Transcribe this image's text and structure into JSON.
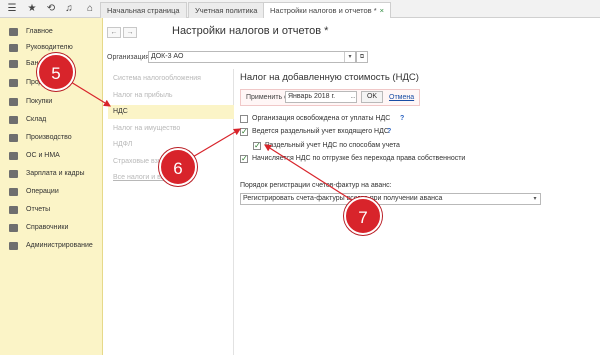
{
  "topbar": {
    "icons": [
      "grid-icon",
      "star-icon",
      "history-icon",
      "bell-icon",
      "home-icon"
    ],
    "tabs": [
      {
        "label": "Начальная страница"
      },
      {
        "label": "Учетная политика"
      },
      {
        "label": "Настройки налогов и отчетов *",
        "close": "×"
      }
    ]
  },
  "sidebar": {
    "items": [
      {
        "label": "Главное"
      },
      {
        "label": "Руководителю"
      },
      {
        "label": "Бан..."
      },
      {
        "label": "Прод..."
      },
      {
        "label": "Покупки"
      },
      {
        "label": "Склад"
      },
      {
        "label": "Производство"
      },
      {
        "label": "ОС и НМА"
      },
      {
        "label": "Зарплата и кадры"
      },
      {
        "label": "Операции"
      },
      {
        "label": "Отчеты"
      },
      {
        "label": "Справочники"
      },
      {
        "label": "Администрирование"
      }
    ]
  },
  "main": {
    "title": "Настройки налогов и отчетов *",
    "back": "←",
    "forward": "→",
    "org_label": "Организация:",
    "org_value": "ДОК-3 АО",
    "org_drop": "▾",
    "org_link": "⧉"
  },
  "left_panel": {
    "items": [
      {
        "label": "Система налогообложения"
      },
      {
        "label": "Налог на прибыль"
      },
      {
        "label": "НДС"
      },
      {
        "label": "Налог на имущество"
      },
      {
        "label": "НДФЛ"
      },
      {
        "label": "Страховые взносы"
      },
      {
        "label": "Все налоги и взносы"
      }
    ]
  },
  "vat": {
    "title": "Налог на добавленную стоимость (НДС)",
    "apply_label": "Применить с:",
    "apply_value": "Январь 2018 г.",
    "apply_drop": "...",
    "ok": "OK",
    "cancel": "Отмена",
    "options": [
      {
        "label": "Организация освобождена от уплаты НДС",
        "checked": false,
        "help": "?"
      },
      {
        "label": "Ведется раздельный учет входящего НДС",
        "checked": true,
        "help": "?"
      },
      {
        "label": "Раздельный учет НДС по способам учета",
        "checked": true
      },
      {
        "label": "Начисляется НДС по отгрузке без перехода права собственности",
        "checked": true
      }
    ],
    "reg_label": "Порядок регистрации счетов-фактур на аванс:",
    "reg_value": "Регистрировать счета-фактуры всегда при получении аванса",
    "reg_drop": "▾"
  },
  "annotations": {
    "badges": [
      "5",
      "6",
      "7"
    ],
    "color": "#d8242b"
  }
}
